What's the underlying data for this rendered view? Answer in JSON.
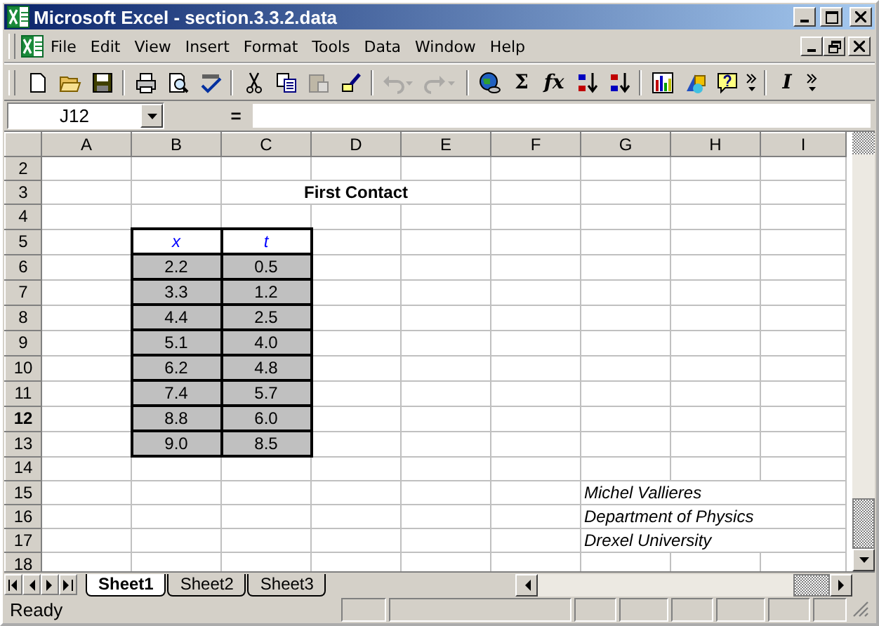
{
  "window": {
    "title": "Microsoft Excel - section.3.3.2.data",
    "controls": [
      {
        "kind": "minimize"
      },
      {
        "kind": "maximize"
      },
      {
        "kind": "close"
      }
    ]
  },
  "menu": {
    "items": [
      "File",
      "Edit",
      "View",
      "Insert",
      "Format",
      "Tools",
      "Data",
      "Window",
      "Help"
    ],
    "controls": [
      {
        "kind": "minimize"
      },
      {
        "kind": "restore"
      },
      {
        "kind": "close"
      }
    ]
  },
  "toolbar": [
    {
      "kind": "new",
      "disabled": false
    },
    {
      "kind": "open",
      "disabled": false
    },
    {
      "kind": "save",
      "disabled": false
    },
    {
      "kind": "sep"
    },
    {
      "kind": "print",
      "disabled": false
    },
    {
      "kind": "preview",
      "disabled": false
    },
    {
      "kind": "spelling",
      "disabled": false
    },
    {
      "kind": "sep"
    },
    {
      "kind": "cut",
      "disabled": false
    },
    {
      "kind": "copy",
      "disabled": false
    },
    {
      "kind": "paste",
      "disabled": true
    },
    {
      "kind": "painter",
      "disabled": false
    },
    {
      "kind": "sep"
    },
    {
      "kind": "undo",
      "disabled": true
    },
    {
      "kind": "redo",
      "disabled": true
    },
    {
      "kind": "sep"
    },
    {
      "kind": "hyperlink",
      "disabled": false
    },
    {
      "kind": "glyph",
      "text": "Σ",
      "disabled": false
    },
    {
      "kind": "glyph-italic",
      "text": "fx",
      "disabled": false
    },
    {
      "kind": "sort-ascending",
      "disabled": false
    },
    {
      "kind": "sort-descending",
      "disabled": false
    },
    {
      "kind": "sep"
    },
    {
      "kind": "chart",
      "disabled": false
    },
    {
      "kind": "drawing",
      "disabled": false
    },
    {
      "kind": "help",
      "disabled": false
    },
    {
      "kind": "more",
      "disabled": false
    },
    {
      "kind": "sep"
    },
    {
      "kind": "glyph-italic",
      "text": "I",
      "disabled": false
    },
    {
      "kind": "more",
      "disabled": false
    }
  ],
  "formula_bar": {
    "name_box": "J12",
    "equals": "="
  },
  "grid": {
    "columns": [
      "A",
      "B",
      "C",
      "D",
      "E",
      "F",
      "G",
      "H",
      "I"
    ],
    "rows": [
      {
        "header": "2",
        "selected": false,
        "kind": "blank",
        "cells": []
      },
      {
        "header": "3",
        "selected": false,
        "kind": "title",
        "cells": [
          "",
          "",
          {
            "text": "First Contact",
            "colspan": 3
          }
        ]
      },
      {
        "header": "4",
        "selected": false,
        "kind": "blank",
        "cells": []
      },
      {
        "header": "5",
        "selected": false,
        "kind": "table-header",
        "cells": [
          "",
          "x",
          "t"
        ]
      },
      {
        "header": "6",
        "selected": false,
        "kind": "table-data",
        "cells": [
          "",
          "2.2",
          "0.5"
        ]
      },
      {
        "header": "7",
        "selected": false,
        "kind": "table-data",
        "cells": [
          "",
          "3.3",
          "1.2"
        ]
      },
      {
        "header": "8",
        "selected": false,
        "kind": "table-data",
        "cells": [
          "",
          "4.4",
          "2.5"
        ]
      },
      {
        "header": "9",
        "selected": false,
        "kind": "table-data",
        "cells": [
          "",
          "5.1",
          "4.0"
        ]
      },
      {
        "header": "10",
        "selected": false,
        "kind": "table-data",
        "cells": [
          "",
          "6.2",
          "4.8"
        ]
      },
      {
        "header": "11",
        "selected": false,
        "kind": "table-data",
        "cells": [
          "",
          "7.4",
          "5.7"
        ]
      },
      {
        "header": "12",
        "selected": true,
        "kind": "table-data",
        "cells": [
          "",
          "8.8",
          "6.0"
        ]
      },
      {
        "header": "13",
        "selected": false,
        "kind": "table-data",
        "cells": [
          "",
          "9.0",
          "8.5"
        ]
      },
      {
        "header": "14",
        "selected": false,
        "kind": "blank",
        "cells": []
      },
      {
        "header": "15",
        "selected": false,
        "kind": "note",
        "cells": [
          "",
          "",
          "",
          "",
          "",
          "",
          {
            "text": "Michel Vallieres",
            "colspan": 3
          }
        ]
      },
      {
        "header": "16",
        "selected": false,
        "kind": "note",
        "cells": [
          "",
          "",
          "",
          "",
          "",
          "",
          {
            "text": "Department of Physics",
            "colspan": 3
          }
        ]
      },
      {
        "header": "17",
        "selected": false,
        "kind": "note",
        "cells": [
          "",
          "",
          "",
          "",
          "",
          "",
          {
            "text": "Drexel University",
            "colspan": 3
          }
        ]
      },
      {
        "header": "18",
        "selected": false,
        "kind": "blank",
        "cells": []
      }
    ]
  },
  "sheet_tabs": [
    {
      "label": "Sheet1",
      "selected": true
    },
    {
      "label": "Sheet2",
      "selected": false
    },
    {
      "label": "Sheet3",
      "selected": false
    }
  ],
  "status_bar": {
    "text": "Ready"
  }
}
